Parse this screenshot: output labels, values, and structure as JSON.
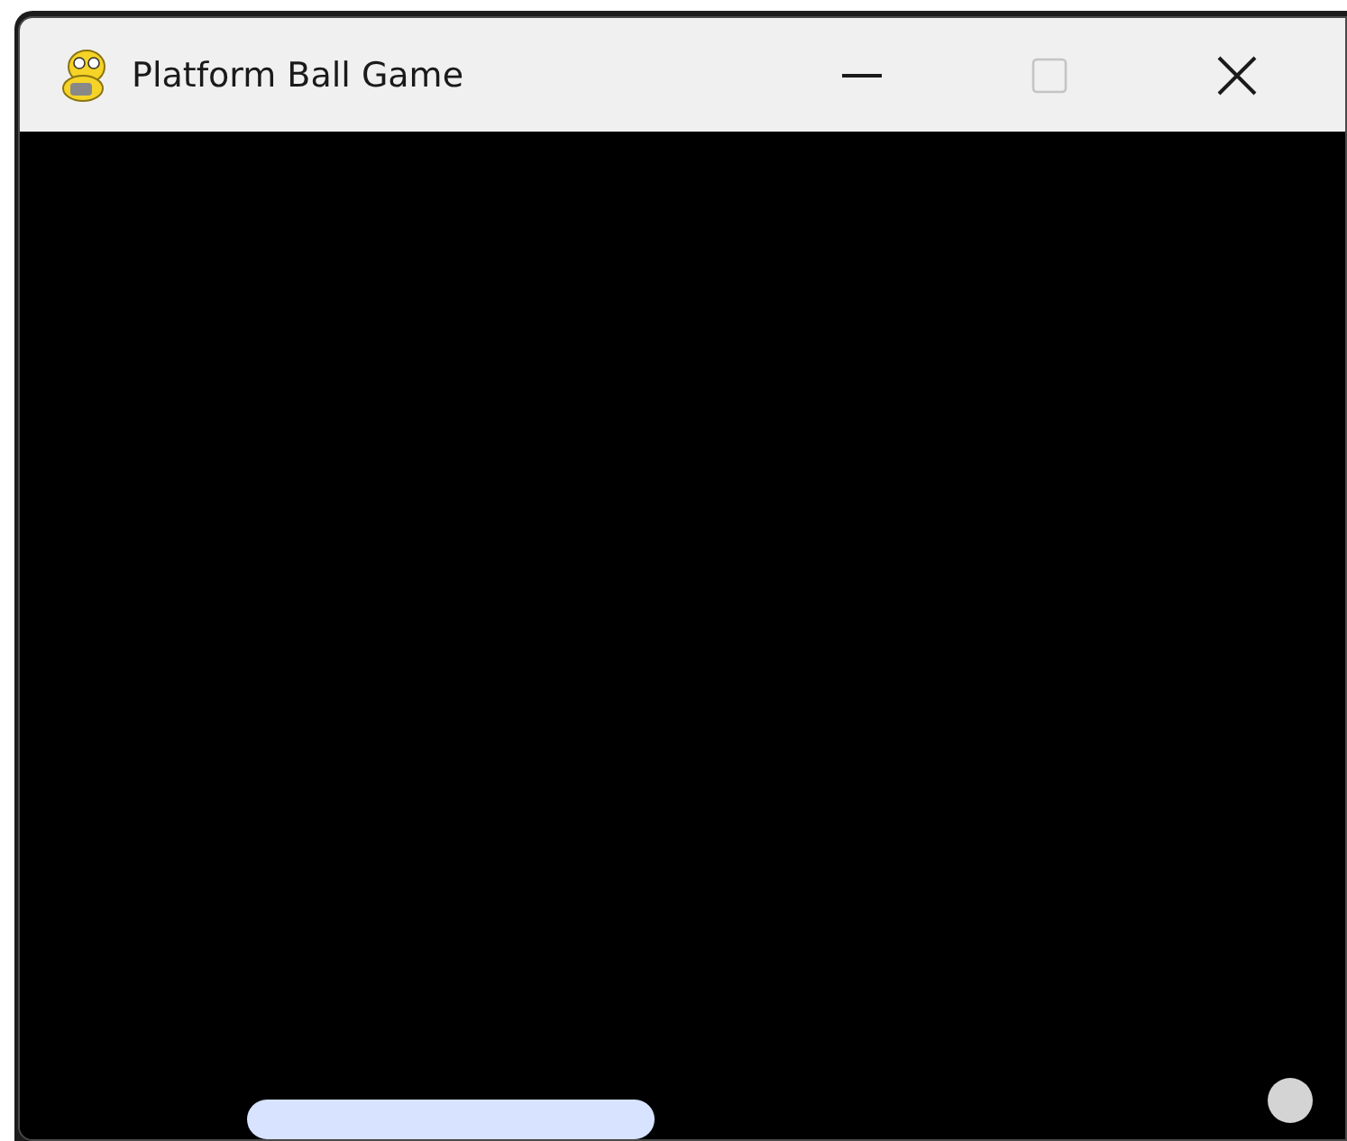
{
  "window": {
    "title": "Platform Ball Game",
    "maximize_disabled": true
  }
}
